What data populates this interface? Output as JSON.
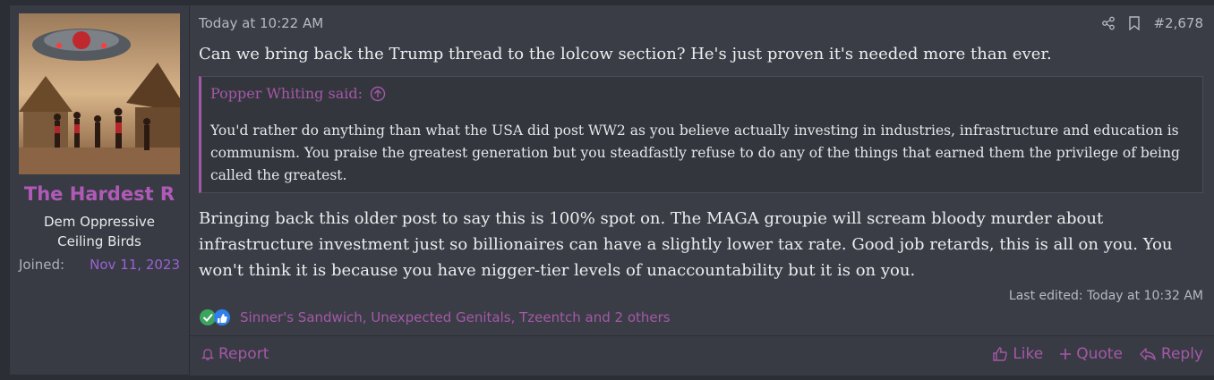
{
  "user": {
    "username": "The Hardest R",
    "title": "Dem Oppressive Ceiling Birds",
    "joined_label": "Joined:",
    "joined_date": "Nov 11, 2023"
  },
  "post": {
    "date": "Today at 10:22 AM",
    "number": "#2,678",
    "intro": "Can we bring back the Trump thread to the lolcow section? He's just proven it's needed more than ever.",
    "quote": {
      "author": "Popper Whiting said:",
      "text": "You'd rather do anything than what the USA did post WW2 as you believe actually investing in industries, infrastructure and education is communism. You praise the greatest generation but you steadfastly refuse to do any of the things that earned them the privilege of being called the greatest."
    },
    "reply": "Bringing back this older post to say this is 100% spot on. The MAGA groupie will scream bloody murder about infrastructure investment just so billionaires can have a slightly lower tax rate. Good job retards, this is all on you. You won't think it is because you have nigger-tier levels of unaccountability but it is on you.",
    "last_edited": "Last edited: Today at 10:32 AM",
    "reactions": "Sinner's Sandwich, Unexpected Genitals, Tzeentch and 2 others"
  },
  "footer": {
    "report": "Report",
    "like": "Like",
    "quote": "Quote",
    "reply": "Reply"
  },
  "colors": {
    "accent": "#a558a8",
    "username": "#b05ab8",
    "joined_date": "#9a62d6",
    "background": "#3a3d45"
  },
  "icons": [
    "share-icon",
    "bookmark-icon",
    "arrow-up-circle-icon",
    "check-reaction-icon",
    "like-reaction-icon",
    "bell-icon",
    "thumbs-up-icon",
    "plus-icon",
    "reply-arrow-icon"
  ]
}
